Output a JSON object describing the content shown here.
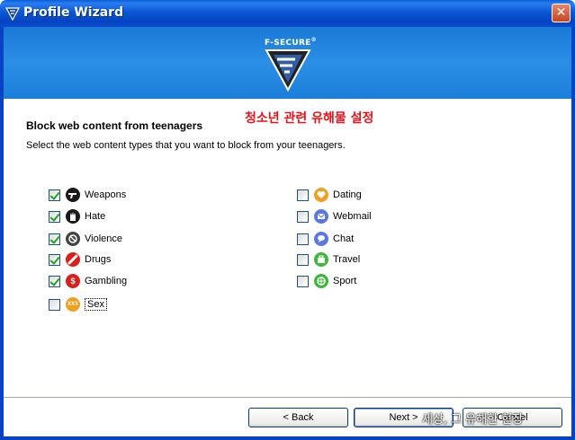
{
  "window": {
    "title": "Profile Wizard",
    "close_glyph": "✕"
  },
  "banner": {
    "brand": "F-SECURE",
    "brand_mark": "®"
  },
  "annotation": "청소년 관련 유해물 설정",
  "page": {
    "heading": "Block web content from teenagers",
    "subtext": "Select the web content types that you want to block from your teenagers."
  },
  "categories_left": [
    {
      "label": "Weapons",
      "checked": true,
      "icon": "weapons-icon",
      "color": "#1a1a1a"
    },
    {
      "label": "Hate",
      "checked": true,
      "icon": "hate-icon",
      "color": "#1a1a1a"
    },
    {
      "label": "Violence",
      "checked": true,
      "icon": "violence-icon",
      "color": "#444444"
    },
    {
      "label": "Drugs",
      "checked": true,
      "icon": "drugs-icon",
      "color": "#d8201c"
    },
    {
      "label": "Gambling",
      "checked": true,
      "icon": "gambling-icon",
      "color": "#d8201c"
    },
    {
      "label": "Sex",
      "checked": false,
      "icon": "sex-icon",
      "color": "#f0a020",
      "icon_text": "XXX"
    }
  ],
  "categories_right": [
    {
      "label": "Dating",
      "checked": false,
      "icon": "dating-icon",
      "color": "#f0a020"
    },
    {
      "label": "Webmail",
      "checked": false,
      "icon": "webmail-icon",
      "color": "#5a78e0"
    },
    {
      "label": "Chat",
      "checked": false,
      "icon": "chat-icon",
      "color": "#5a78e0"
    },
    {
      "label": "Travel",
      "checked": false,
      "icon": "travel-icon",
      "color": "#3cb83c"
    },
    {
      "label": "Sport",
      "checked": false,
      "icon": "sport-icon",
      "color": "#3cb83c"
    }
  ],
  "buttons": {
    "back": "< Back",
    "next": "Next >",
    "cancel": "Cancel"
  },
  "overlay": "세상, 그 유해한 현장"
}
